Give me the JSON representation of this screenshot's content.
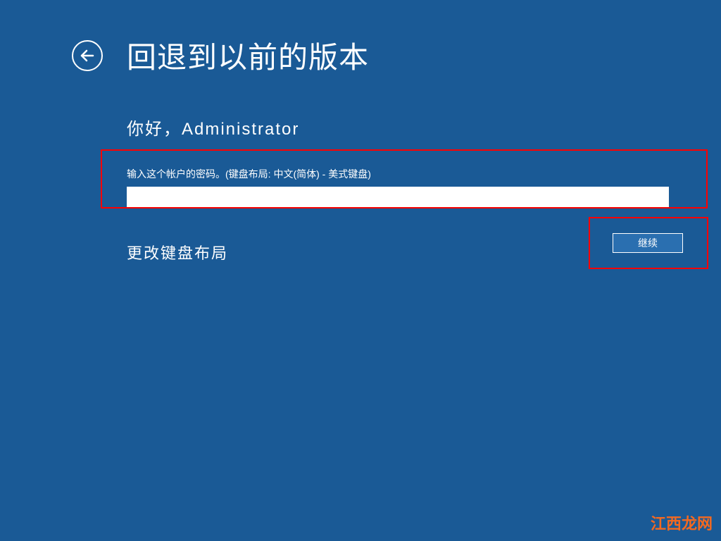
{
  "header": {
    "title": "回退到以前的版本"
  },
  "greeting": {
    "text": "你好，Administrator"
  },
  "password": {
    "label": "输入这个帐户的密码。(键盘布局: 中文(简体) - 美式键盘)",
    "value": ""
  },
  "links": {
    "change_keyboard_layout": "更改键盘布局"
  },
  "buttons": {
    "continue": "继续"
  },
  "watermark": {
    "text": "江西龙网"
  }
}
